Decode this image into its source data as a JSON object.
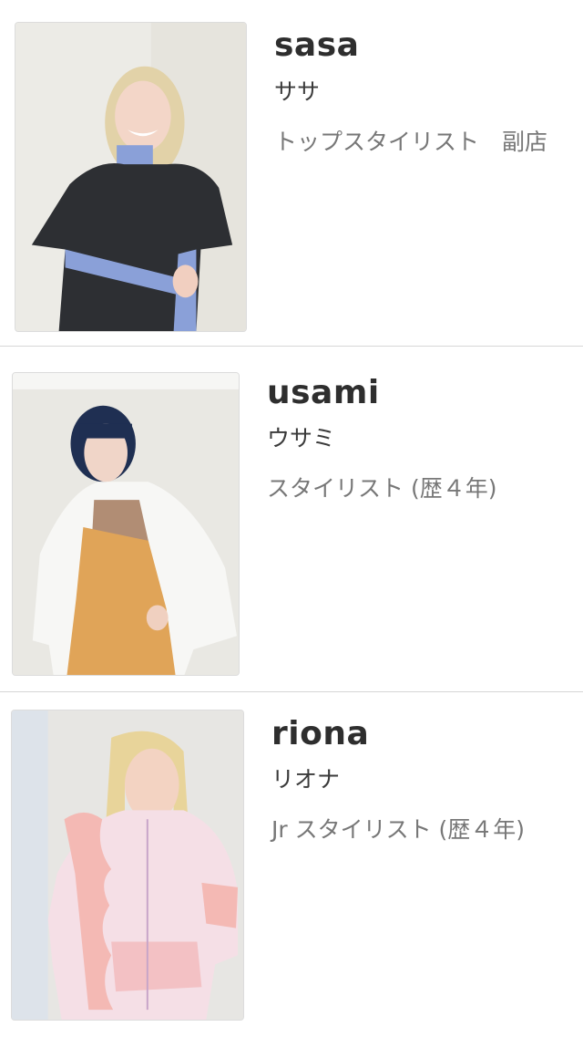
{
  "stylists": [
    {
      "name": "sasa",
      "kana": "ササ",
      "role": "トップスタイリスト　副店"
    },
    {
      "name": "usami",
      "kana": "ウサミ",
      "role": "スタイリスト (歴４年)"
    },
    {
      "name": "riona",
      "kana": "リオナ",
      "role": "Jr スタイリスト (歴４年)"
    }
  ],
  "colors": {
    "name_text": "#2e2e2e",
    "role_text": "#777777",
    "divider": "#d6d6d6"
  }
}
